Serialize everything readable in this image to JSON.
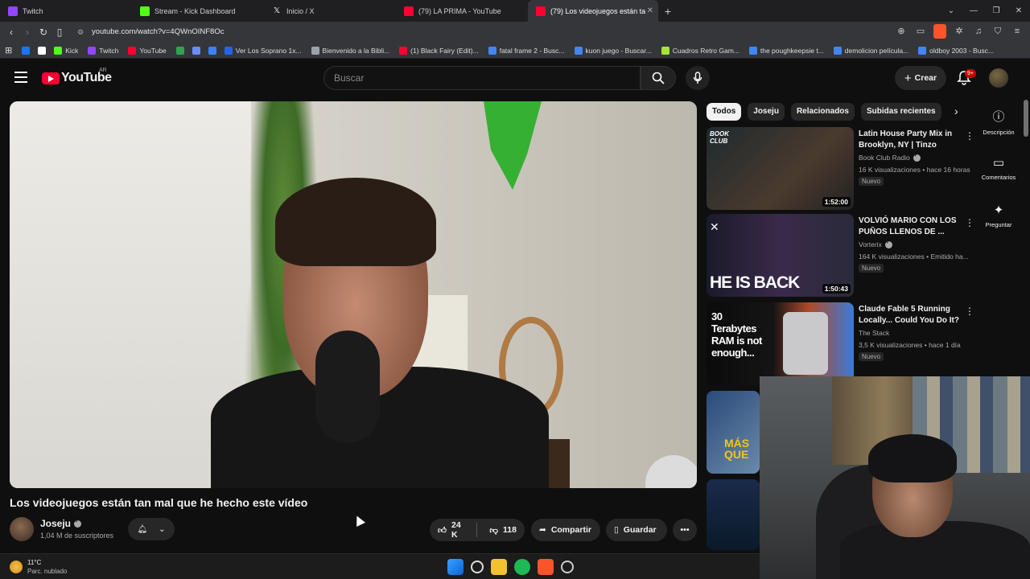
{
  "browser": {
    "tabs": [
      {
        "label": "Twitch",
        "color": "#9146ff"
      },
      {
        "label": "Stream - Kick Dashboard",
        "color": "#53fc18"
      },
      {
        "label": "Inicio / X",
        "color": "#ffffff"
      },
      {
        "label": "(79) LA PRIMA - YouTube",
        "color": "#ff0033"
      },
      {
        "label": "(79) Los videojuegos están ta",
        "color": "#ff0033"
      }
    ],
    "url": "youtube.com/watch?v=4QWnOINF8Oc",
    "bookmarks": [
      {
        "label": "",
        "color": "#1877f2"
      },
      {
        "label": "",
        "color": "#ffffff"
      },
      {
        "label": "Kick",
        "color": "#53fc18"
      },
      {
        "label": "Twitch",
        "color": "#9146ff"
      },
      {
        "label": "YouTube",
        "color": "#ff0033"
      },
      {
        "label": "",
        "color": "#2ea44f"
      },
      {
        "label": "",
        "color": "#6a8cff"
      },
      {
        "label": "",
        "color": "#3b82f6"
      },
      {
        "label": "Ver Los Soprano 1x...",
        "color": "#2563eb"
      },
      {
        "label": "Bienvenido a la Bibli...",
        "color": "#9ca3af"
      },
      {
        "label": "(1) Black Fairy (Edit)...",
        "color": "#ff0033"
      },
      {
        "label": "fatal frame 2 - Busc...",
        "color": "#4285f4"
      },
      {
        "label": "kuon juego - Buscar...",
        "color": "#4285f4"
      },
      {
        "label": "Cuadros Retro Gam...",
        "color": "#a3e635"
      },
      {
        "label": "the poughkeepsie t...",
        "color": "#4285f4"
      },
      {
        "label": "demolicion película...",
        "color": "#4285f4"
      },
      {
        "label": "oldboy 2003 - Busc...",
        "color": "#4285f4"
      }
    ]
  },
  "youtube": {
    "logo_text": "YouTube",
    "country_code": "AR",
    "search_placeholder": "Buscar",
    "create_label": "Crear",
    "notifications": "9+",
    "video": {
      "title": "Los videojuegos están tan mal que he hecho este vídeo",
      "channel": "Joseju",
      "subscribers": "1,04 M de suscriptores",
      "likes": "24 K",
      "dislikes": "118",
      "share_label": "Compartir",
      "save_label": "Guardar"
    },
    "chips": [
      "Todos",
      "Joseju",
      "Relacionados",
      "Subidas recientes"
    ],
    "recommendations": [
      {
        "title": "Latin House Party Mix in Brooklyn, NY | Tinzo",
        "channel": "Book Club Radio",
        "meta": "16 K visualizaciones • hace 16 horas",
        "badge": "Nuevo",
        "duration": "1:52:00",
        "thumb_text": "BOOK CLUB"
      },
      {
        "title": "VOLVIÓ MARIO CON LOS PUÑOS LLENOS DE ...",
        "channel": "Vorterix",
        "meta": "164 K visualizaciones • Emitido ha...",
        "badge": "Nuevo",
        "duration": "1:50:43",
        "thumb_text": "HE IS BACK"
      },
      {
        "title": "Claude Fable 5 Running Locally... Could You Do It?",
        "channel": "The Stack",
        "meta": "3,5 K visualizaciones • hace 1 día",
        "badge": "Nuevo",
        "duration": "",
        "thumb_text": "30 Terabytes RAM is not enough..."
      },
      {
        "title": "",
        "channel": "",
        "meta": "",
        "badge": "",
        "duration": "",
        "thumb_text": "MÁS QUE"
      }
    ],
    "side_actions": [
      "Descripción",
      "Comentarios",
      "Preguntar"
    ]
  },
  "taskbar": {
    "temperature": "11°C",
    "weather": "Parc. nublado"
  }
}
